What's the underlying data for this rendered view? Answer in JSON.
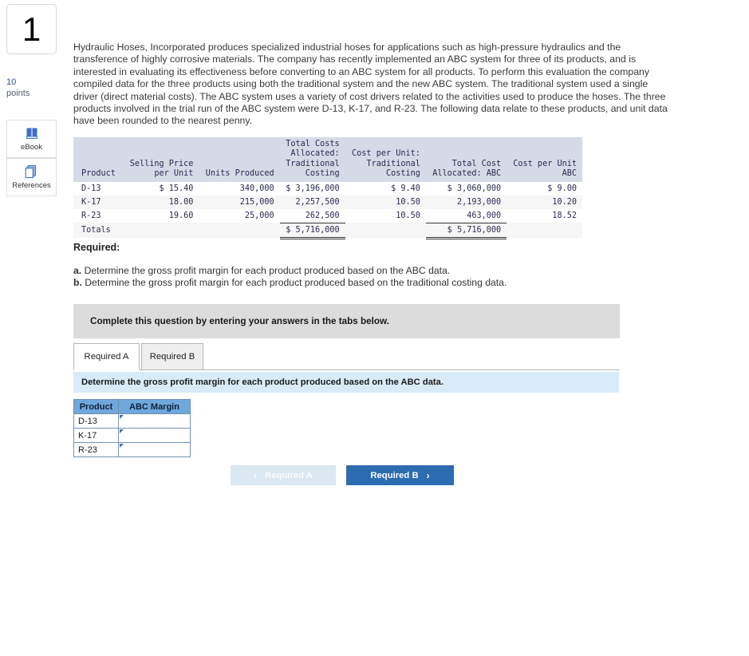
{
  "sidebar": {
    "question_number": "1",
    "points_value": "10",
    "points_label": "points",
    "ebook_label": "eBook",
    "references_label": "References"
  },
  "intro": {
    "paragraph": "Hydraulic Hoses, Incorporated produces specialized industrial hoses for applications such as high-pressure hydraulics and the transference of highly corrosive materials. The company has recently implemented an ABC system for three of its products, and is interested in evaluating its effectiveness before converting to an ABC system for all products. To perform this evaluation the company compiled data for the three products using both the traditional system and the new ABC system. The traditional system used a single driver (direct material costs). The ABC system uses a variety of cost drivers related to the activities used to produce the hoses. The three products involved in the trial run of the ABC system were D-13, K-17, and R-23. The following data relate to these products, and unit data have been rounded to the nearest penny."
  },
  "data_table": {
    "headers": [
      "Product",
      "Selling Price\nper Unit",
      "Units Produced",
      "Total Costs\nAllocated:\nTraditional\nCosting",
      "Cost per Unit:\nTraditional\nCosting",
      "Total Cost\nAllocated: ABC",
      "Cost per Unit\nABC"
    ],
    "rows": [
      {
        "product": "D-13",
        "selling_price_per_unit": "$ 15.40",
        "units_produced": "340,000",
        "total_costs_traditional": "$ 3,196,000",
        "cost_per_unit_traditional": "$ 9.40",
        "total_cost_abc": "$ 3,060,000",
        "cost_per_unit_abc": "$ 9.00"
      },
      {
        "product": "K-17",
        "selling_price_per_unit": "18.00",
        "units_produced": "215,000",
        "total_costs_traditional": "2,257,500",
        "cost_per_unit_traditional": "10.50",
        "total_cost_abc": "2,193,000",
        "cost_per_unit_abc": "10.20"
      },
      {
        "product": "R-23",
        "selling_price_per_unit": "19.60",
        "units_produced": "25,000",
        "total_costs_traditional": "262,500",
        "cost_per_unit_traditional": "10.50",
        "total_cost_abc": "463,000",
        "cost_per_unit_abc": "18.52"
      }
    ],
    "totals": {
      "label": "Totals",
      "selling_price_per_unit": "",
      "units_produced": "",
      "total_costs_traditional": "$ 5,716,000",
      "cost_per_unit_traditional": "",
      "total_cost_abc": "$ 5,716,000",
      "cost_per_unit_abc": ""
    }
  },
  "required": {
    "heading": "Required:",
    "item_a_label": "a.",
    "item_a_text": "Determine the gross profit margin for each product produced based on the ABC data.",
    "item_b_label": "b.",
    "item_b_text": "Determine the gross profit margin for each product produced based on the traditional costing data."
  },
  "banner": {
    "text": "Complete this question by entering your answers in the tabs below."
  },
  "tabs": [
    {
      "label": "Required A",
      "active": true
    },
    {
      "label": "Required B",
      "active": false
    }
  ],
  "prompt": {
    "text": "Determine the gross profit margin for each product produced based on the ABC data."
  },
  "answer_table": {
    "headers": [
      "Product",
      "ABC Margin"
    ],
    "rows": [
      {
        "product": "D-13",
        "abc_margin": ""
      },
      {
        "product": "K-17",
        "abc_margin": ""
      },
      {
        "product": "R-23",
        "abc_margin": ""
      }
    ]
  },
  "nav": {
    "prev_label": "Required A",
    "prev_chevron": "‹",
    "next_label": "Required B",
    "next_chevron": "›"
  },
  "colors": {
    "table_header_bg": "#d5dae6",
    "answer_header_bg": "#6fa8dc",
    "banner_bg": "#dcdcdc",
    "prompt_bg": "#d9ebf9",
    "primary_button": "#2c6cb0",
    "disabled_button": "#dbe7f1",
    "icon_blue": "#3f6fc4"
  }
}
